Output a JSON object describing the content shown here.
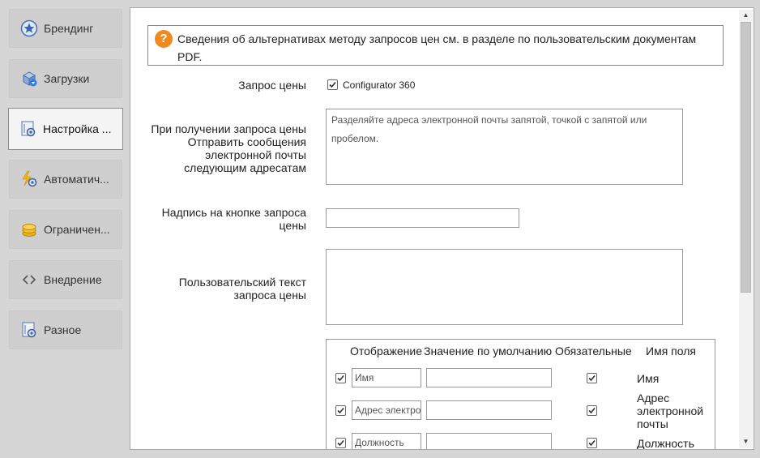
{
  "sidebar": {
    "items": [
      {
        "label": "Брендинг",
        "icon": "star-badge-icon"
      },
      {
        "label": "Загрузки",
        "icon": "download-icon"
      },
      {
        "label": "Настройка ...",
        "icon": "settings-doc-icon"
      },
      {
        "label": "Автоматич...",
        "icon": "lightning-gear-icon"
      },
      {
        "label": "Ограничен...",
        "icon": "coins-icon"
      },
      {
        "label": "Внедрение",
        "icon": "code-brackets-icon"
      },
      {
        "label": "Разное",
        "icon": "misc-settings-icon"
      }
    ]
  },
  "info": {
    "text": "Сведения об альтернативах методу запросов цен см. в разделе по пользовательским документам PDF."
  },
  "form": {
    "price_request_label": "Запрос цены",
    "configurator_label": "Configurator 360",
    "configurator_checked": true,
    "email_label": "При получении запроса цены Отправить сообщения электронной почты следующим адресатам",
    "email_placeholder": "Разделяйте адреса электронной почты запятой, точкой с запятой или пробелом.",
    "button_caption_label": "Надпись на кнопке запроса цены",
    "button_caption_value": "",
    "custom_text_label": "Пользовательский текст запроса цены",
    "custom_text_value": ""
  },
  "fields_table": {
    "headers": [
      "Отображение",
      "Значение по умолчанию",
      "Обязательные",
      "Имя поля"
    ],
    "rows": [
      {
        "display": true,
        "field_text": "Имя",
        "default_value": "",
        "required": true,
        "name": "Имя"
      },
      {
        "display": true,
        "field_text": "Адрес электронной",
        "default_value": "",
        "required": true,
        "name": "Адрес электронной почты"
      },
      {
        "display": true,
        "field_text": "Должность",
        "default_value": "",
        "required": true,
        "name": "Должность"
      }
    ]
  }
}
